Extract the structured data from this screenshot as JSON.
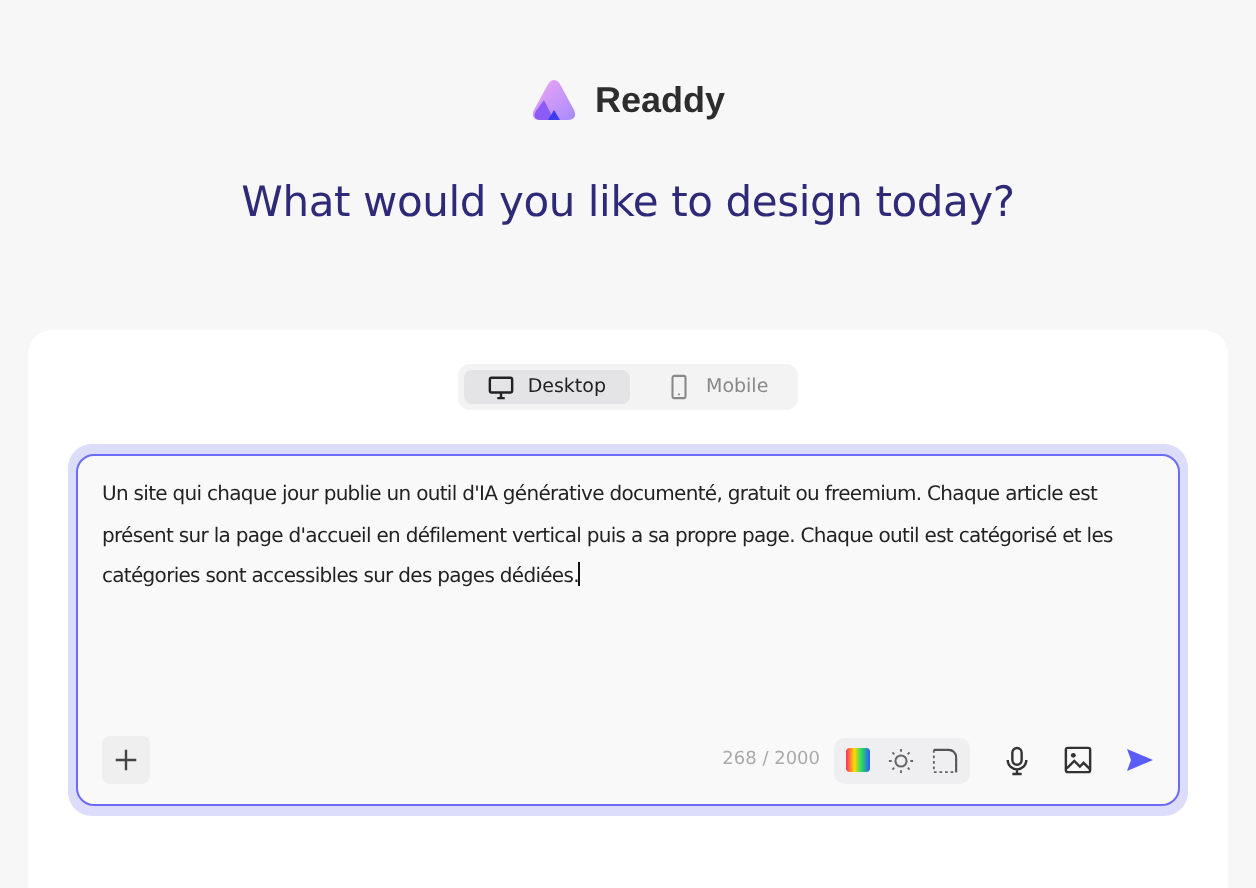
{
  "brand": {
    "name": "Readdy"
  },
  "heading": "What would you like to design today?",
  "device_tabs": [
    {
      "kind": "desktop",
      "label": "Desktop",
      "selected": true
    },
    {
      "kind": "mobile",
      "label": "Mobile",
      "selected": false
    }
  ],
  "prompt": {
    "value": "Un site qui chaque jour publie un outil d'IA générative documenté, gratuit ou freemium. Chaque article est présent sur la page d'accueil en défilement vertical puis a sa propre page. Chaque outil est catégorisé et les catégories sont accessibles sur des pages dédiées.",
    "counter": "268 / 2000"
  }
}
